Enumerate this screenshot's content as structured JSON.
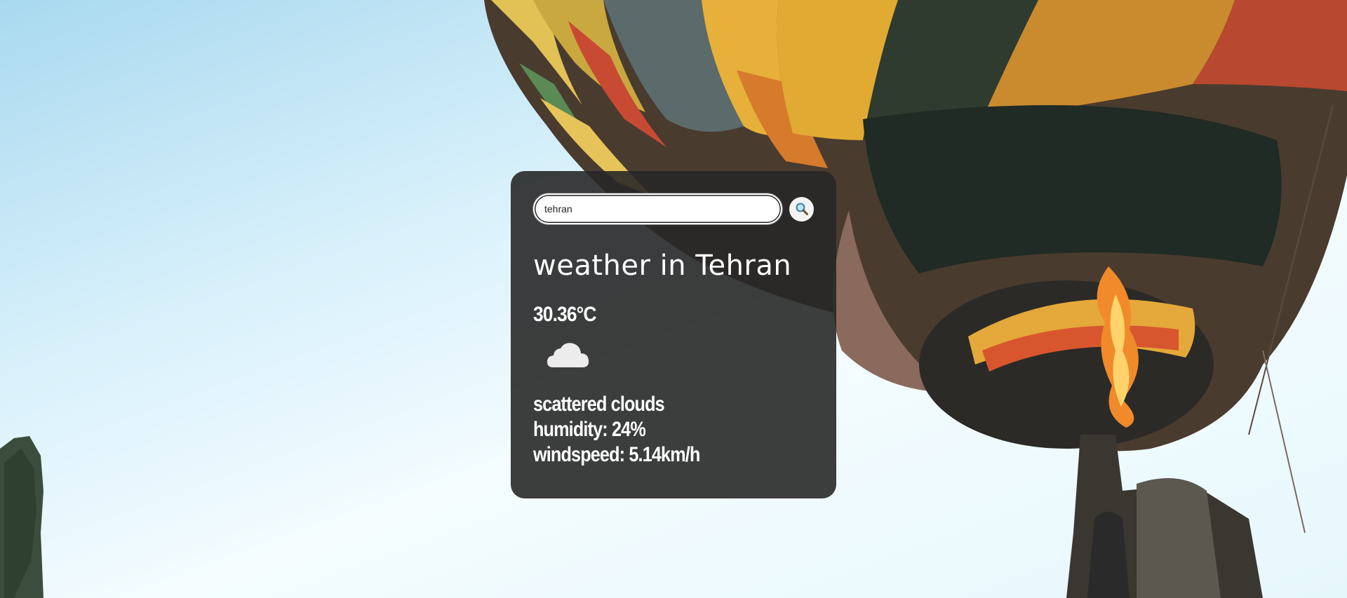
{
  "search": {
    "value": "tehran",
    "icon": "search-icon"
  },
  "weather": {
    "title": "weather in Tehran",
    "temperature": "30.36°C",
    "icon": "cloud-icon",
    "description": "scattered clouds",
    "humidity": "humidity: 24%",
    "windspeed": "windspeed: 5.14km/h"
  },
  "colors": {
    "card_bg": "#282828",
    "text": "#ffffff"
  }
}
